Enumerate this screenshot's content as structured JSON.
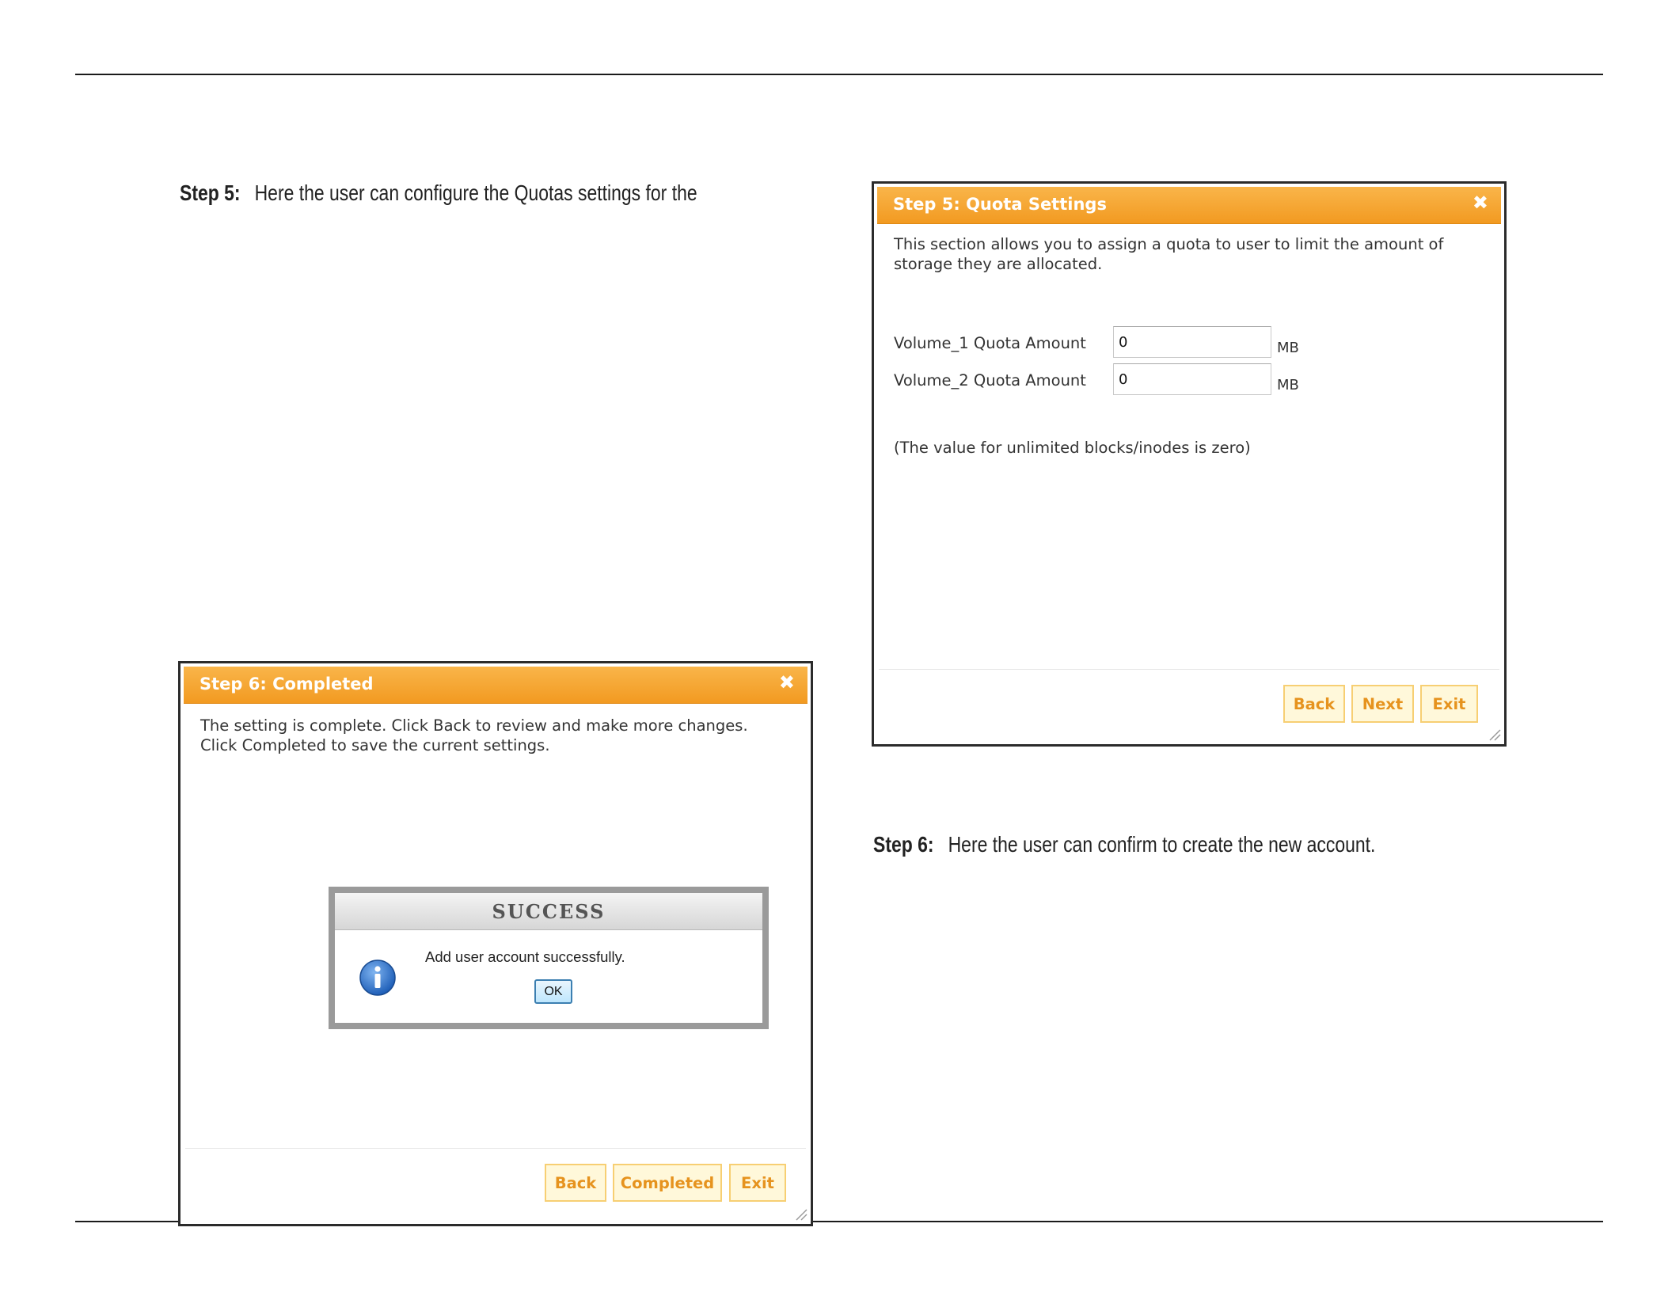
{
  "step5_text": {
    "label": "Step 5:",
    "body": "Here the user can configure the Quotas settings for the"
  },
  "step6_text": {
    "label": "Step 6:",
    "body": "Here the user can confirm to create the new account."
  },
  "quota_dialog": {
    "title": "Step 5: Quota Settings",
    "close_glyph": "✖",
    "description": "This section allows you to assign a quota to user to limit the amount of\nstorage they are allocated.",
    "fields": [
      {
        "label": "Volume_1 Quota Amount",
        "value": "0",
        "unit": "MB"
      },
      {
        "label": "Volume_2 Quota Amount",
        "value": "0",
        "unit": "MB"
      }
    ],
    "note": "(The value for unlimited blocks/inodes is zero)",
    "buttons": {
      "back": "Back",
      "next": "Next",
      "exit": "Exit"
    }
  },
  "completed_dialog": {
    "title": "Step 6: Completed",
    "close_glyph": "✖",
    "description": "The setting is complete. Click Back to review and make more changes.\nClick Completed to save the current settings.",
    "buttons": {
      "back": "Back",
      "completed": "Completed",
      "exit": "Exit"
    }
  },
  "success_popup": {
    "title": "SUCCESS",
    "message": "Add user account successfully.",
    "ok_label": "OK",
    "icon": "info-icon"
  },
  "colors": {
    "titlebar": "#f29a21",
    "button_text": "#e6931e",
    "button_border": "#f7cf73",
    "info_blue": "#1f5fb8"
  }
}
